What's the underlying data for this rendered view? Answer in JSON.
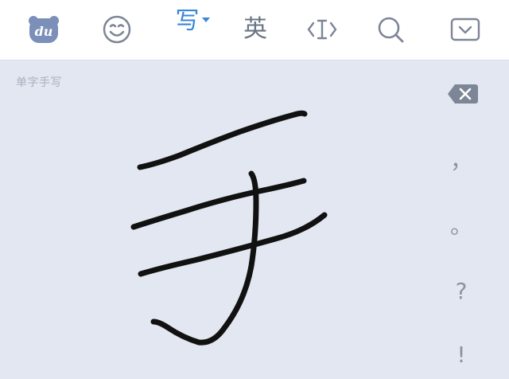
{
  "toolbar": {
    "mode_label": "写",
    "lang_label": "英"
  },
  "pad": {
    "hint": "单字手写",
    "stroke_color": "#111111"
  },
  "side_keys": {
    "comma": "，",
    "period": "。",
    "question": "?",
    "exclaim": "!"
  },
  "colors": {
    "accent": "#3a86d8",
    "icon": "#7d8696",
    "pad_bg": "#e3e7f1",
    "toolbar_bg": "#ffffff",
    "logo": "#7b8fb8"
  },
  "icons": [
    "baidu-logo-icon",
    "emoji-icon",
    "handwriting-mode",
    "english-mode",
    "cursor-icon",
    "search-icon",
    "collapse-keyboard-icon",
    "backspace-icon"
  ]
}
